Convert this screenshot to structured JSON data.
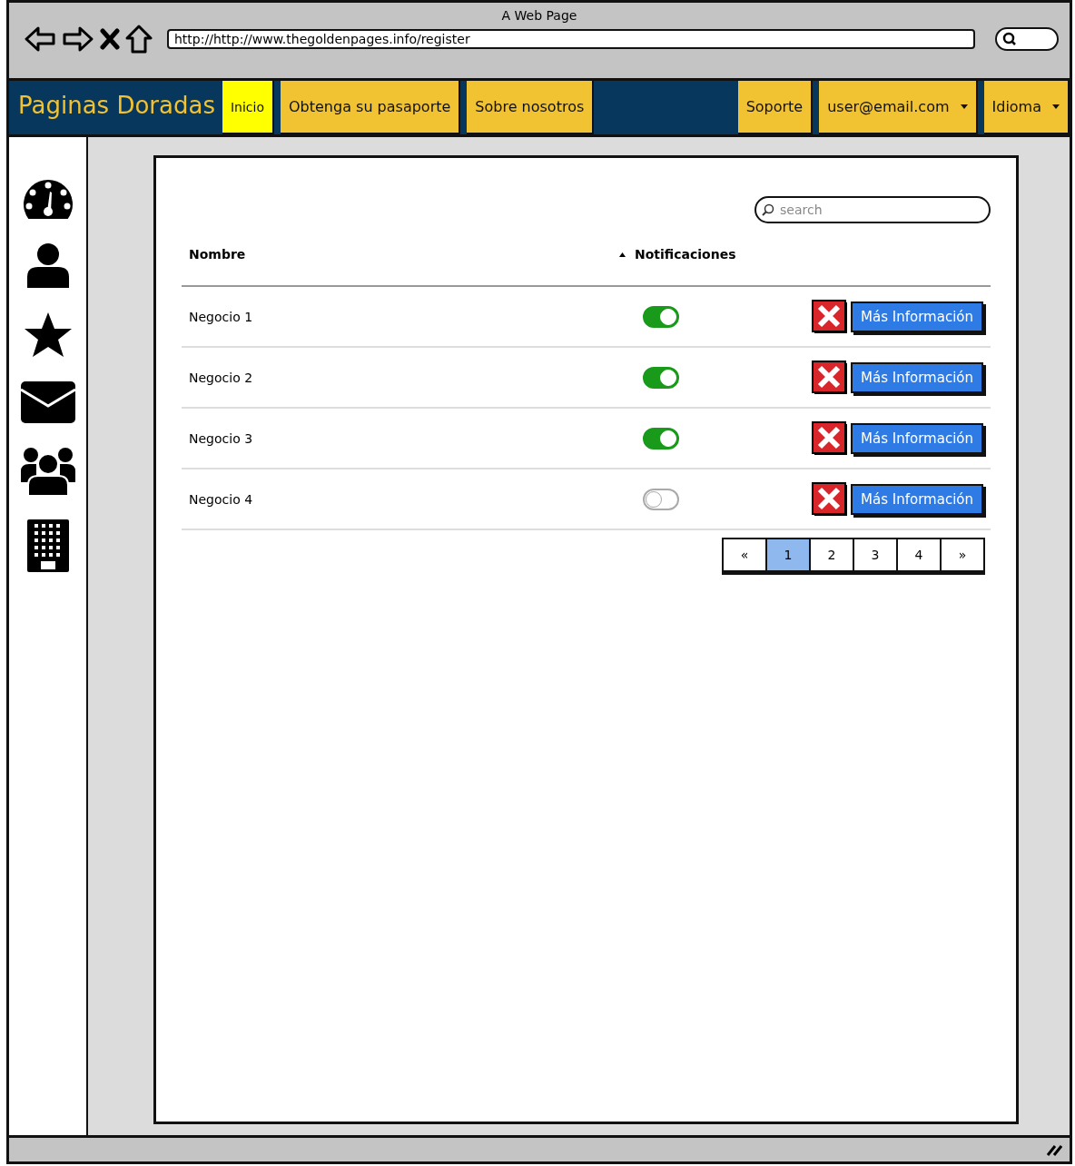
{
  "browser": {
    "title": "A Web Page",
    "url": "http://http://www.thegoldenpages.info/register"
  },
  "navbar": {
    "brand": "Paginas Doradas",
    "left_items": [
      {
        "label": "Inicio",
        "selected": true,
        "kind": "link"
      },
      {
        "label": "Obtenga su pasaporte",
        "selected": false,
        "kind": "link"
      },
      {
        "label": "Sobre nosotros",
        "selected": false,
        "kind": "link"
      }
    ],
    "right_items": [
      {
        "label": "Soporte",
        "selected": false,
        "kind": "link"
      },
      {
        "label": "user@email.com",
        "selected": false,
        "kind": "dropdown"
      },
      {
        "label": "Idioma",
        "selected": false,
        "kind": "dropdown"
      }
    ]
  },
  "search": {
    "placeholder": "search"
  },
  "table": {
    "columns": [
      {
        "label": "Nombre",
        "sorted": false
      },
      {
        "label": "Notificaciones",
        "sorted": true
      }
    ],
    "rows": [
      {
        "name": "Negocio 1",
        "notifications": true,
        "action": "Más Información"
      },
      {
        "name": "Negocio 2",
        "notifications": true,
        "action": "Más Información"
      },
      {
        "name": "Negocio 3",
        "notifications": true,
        "action": "Más Información"
      },
      {
        "name": "Negocio 4",
        "notifications": false,
        "action": "Más Información"
      }
    ]
  },
  "pagination": {
    "prev": "«",
    "next": "»",
    "pages": [
      {
        "label": "1",
        "selected": true
      },
      {
        "label": "2",
        "selected": false
      },
      {
        "label": "3",
        "selected": false
      },
      {
        "label": "4",
        "selected": false
      }
    ]
  }
}
